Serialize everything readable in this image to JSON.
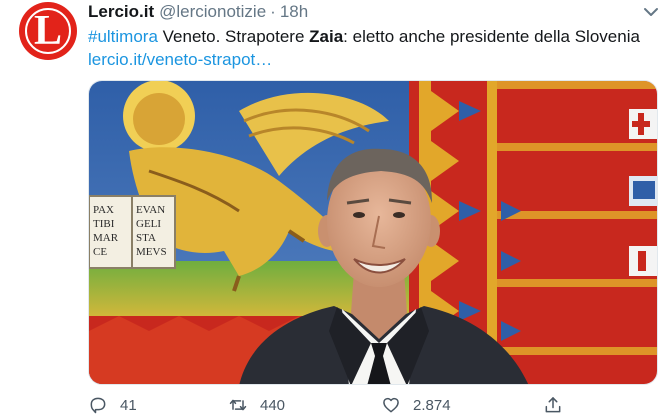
{
  "account": {
    "name": "Lercio.it",
    "handle": "@lercionotizie",
    "separator": "·",
    "time": "18h",
    "avatar_letter": "L",
    "avatar_color": "#e2231a"
  },
  "tweet": {
    "hashtag": "#ultimora",
    "text_1": " Veneto. Strapotere ",
    "bold_name": "Zaia",
    "text_2": ": eletto anche presidente della Slovenia",
    "link": "lercio.it/veneto-strapot…"
  },
  "media": {
    "flag_book_text_left": [
      "PAX",
      "TIBI",
      "MAR",
      "CE"
    ],
    "flag_book_text_right": [
      "EVAN",
      "GELI",
      "STA",
      "MEVS"
    ]
  },
  "actions": {
    "reply_icon": "reply-icon",
    "reply_count": "41",
    "retweet_icon": "retweet-icon",
    "retweet_count": "440",
    "like_icon": "heart-icon",
    "like_count": "2.874",
    "share_icon": "share-icon"
  },
  "colors": {
    "link": "#1b95e0",
    "muted": "#657786",
    "flag_red": "#c8281e",
    "flag_gold": "#e2a72a"
  }
}
